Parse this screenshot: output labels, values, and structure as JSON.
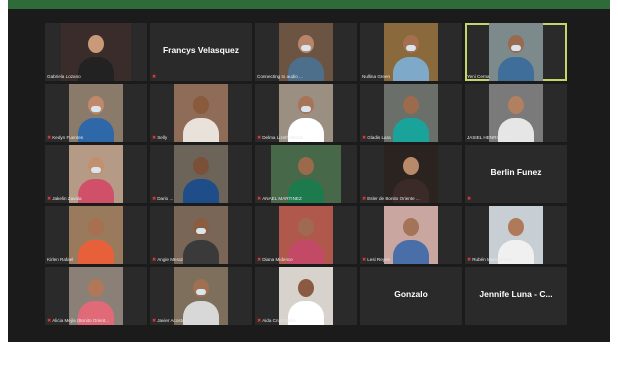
{
  "colors": {
    "brand_bar": "#2f6b38",
    "active_speaker": "#c7d36b",
    "muted": "#e23a3a"
  },
  "participants": [
    {
      "name": "Gabriela Lozano",
      "video": "wide",
      "muted": false,
      "tone": "#3a2c2a",
      "skin": "#c89a7a",
      "shirt": "#222222",
      "mask": false
    },
    {
      "name": "Francys Velasquez",
      "video": "none",
      "muted": true
    },
    {
      "name": "Connecting to audio ...",
      "video": "narrow",
      "muted": false,
      "tone": "#6b5442",
      "skin": "#b8856a",
      "shirt": "#4d6f8c",
      "mask": true
    },
    {
      "name": "Nullina Green",
      "video": "narrow",
      "muted": false,
      "tone": "#8a6a3c",
      "skin": "#a4704e",
      "shirt": "#7ea9c9",
      "mask": true
    },
    {
      "name": "Yeni Cerna",
      "video": "narrow",
      "muted": false,
      "tone": "#7c8a8c",
      "skin": "#9a6a4e",
      "shirt": "#3f6e9a",
      "mask": true,
      "active": true
    },
    {
      "name": "Kedyn Fuentes",
      "video": "narrow",
      "muted": true,
      "tone": "#8a7a6a",
      "skin": "#c08a6a",
      "shirt": "#2e68a8",
      "mask": true
    },
    {
      "name": "Selly",
      "video": "narrow",
      "muted": true,
      "tone": "#8e6c58",
      "skin": "#8a5a3c",
      "shirt": "#e9e2da",
      "mask": false
    },
    {
      "name": "Delma Lizeth Meraz ...",
      "video": "narrow",
      "muted": true,
      "tone": "#9b8f82",
      "skin": "#a87458",
      "shirt": "#ffffff",
      "mask": true
    },
    {
      "name": "Gladis Lara",
      "video": "narrow",
      "muted": true,
      "tone": "#6a6f6a",
      "skin": "#9c6a4c",
      "shirt": "#1aa39a",
      "mask": false
    },
    {
      "name": "JASIEL HENRIQUEZ",
      "video": "narrow",
      "muted": false,
      "tone": "#7a7a7a",
      "skin": "#b08060",
      "shirt": "#e6e6e6",
      "mask": false
    },
    {
      "name": "Jakelin Zavala",
      "video": "narrow",
      "muted": true,
      "tone": "#b59a86",
      "skin": "#c09070",
      "shirt": "#d0506a",
      "mask": true
    },
    {
      "name": "Dario ...",
      "video": "narrow",
      "muted": true,
      "tone": "#6c6458",
      "skin": "#7a5038",
      "shirt": "#1e4d8a",
      "mask": false
    },
    {
      "name": "ANAEL MARTINEZ",
      "video": "wide",
      "muted": true,
      "tone": "#48684a",
      "skin": "#9a6a4a",
      "shirt": "#1c7a4c",
      "mask": false
    },
    {
      "name": "Esler de Bonito Oriente ...",
      "video": "narrow",
      "muted": true,
      "tone": "#2a2320",
      "skin": "#b88a6a",
      "shirt": "#3a2a28",
      "mask": false
    },
    {
      "name": "Berlin Funez",
      "video": "none",
      "muted": true
    },
    {
      "name": "Kirlen Rafael",
      "video": "narrow",
      "muted": false,
      "tone": "#9a7a5c",
      "skin": "#a87050",
      "shirt": "#e8603a",
      "mask": false
    },
    {
      "name": "Angie Meraz",
      "video": "narrow",
      "muted": true,
      "tone": "#7a6656",
      "skin": "#8a5c40",
      "shirt": "#3a3a3a",
      "mask": true
    },
    {
      "name": "Diana Midence",
      "video": "narrow",
      "muted": true,
      "tone": "#b0584c",
      "skin": "#a06a52",
      "shirt": "#c24a66",
      "mask": false
    },
    {
      "name": "Lesi Reyes",
      "video": "narrow",
      "muted": true,
      "tone": "#c9a6a0",
      "skin": "#a47458",
      "shirt": "#4a6ea8",
      "mask": false
    },
    {
      "name": "Rubén Manzanares",
      "video": "narrow",
      "muted": true,
      "tone": "#c8cfd4",
      "skin": "#b07a5a",
      "shirt": "#f0f0f0",
      "mask": false
    },
    {
      "name": "Alicia Mejía (Bonito Orient...",
      "video": "narrow",
      "muted": true,
      "tone": "#8a8078",
      "skin": "#b07858",
      "shirt": "#e06a78",
      "mask": false
    },
    {
      "name": "Javier Acosta",
      "video": "narrow",
      "muted": true,
      "tone": "#7e6e5c",
      "skin": "#a07050",
      "shirt": "#d8d8d8",
      "mask": true
    },
    {
      "name": "Aida Cruz Colón",
      "video": "narrow",
      "muted": true,
      "tone": "#d8d2cc",
      "skin": "#8a5a42",
      "shirt": "#ffffff",
      "mask": false
    },
    {
      "name": "Gonzalo",
      "video": "none",
      "muted": false
    },
    {
      "name": "Jennife Luna - C...",
      "video": "none",
      "muted": false
    }
  ]
}
